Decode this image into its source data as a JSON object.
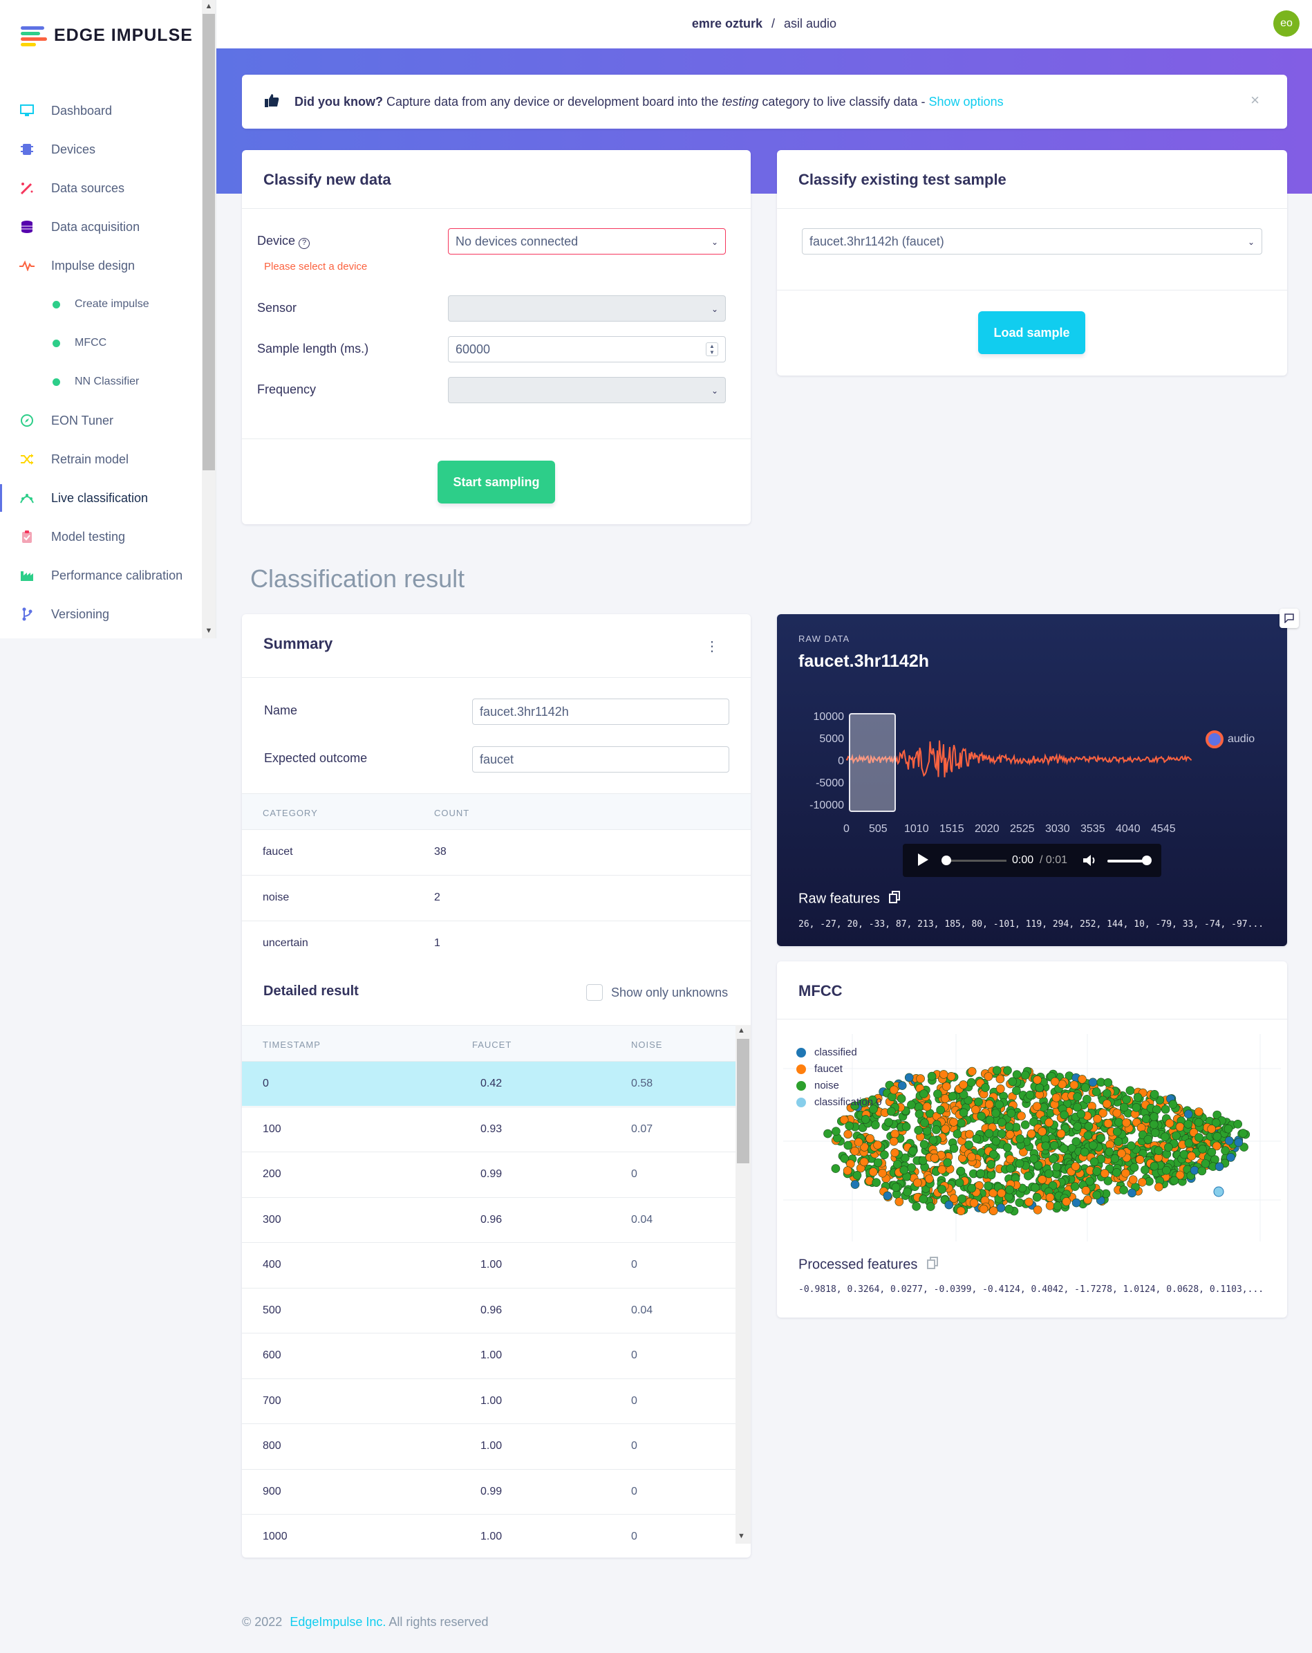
{
  "app": {
    "logo_text": "EDGE IMPULSE"
  },
  "sidebar": {
    "items": [
      {
        "label": "Dashboard",
        "icon": "monitor-icon"
      },
      {
        "label": "Devices",
        "icon": "chip-icon"
      },
      {
        "label": "Data sources",
        "icon": "wand-icon"
      },
      {
        "label": "Data acquisition",
        "icon": "database-icon"
      },
      {
        "label": "Impulse design",
        "icon": "pulse-icon"
      },
      {
        "label": "Create impulse",
        "icon": "dot-icon"
      },
      {
        "label": "MFCC",
        "icon": "dot-icon"
      },
      {
        "label": "NN Classifier",
        "icon": "dot-icon"
      },
      {
        "label": "EON Tuner",
        "icon": "compass-icon"
      },
      {
        "label": "Retrain model",
        "icon": "shuffle-icon"
      },
      {
        "label": "Live classification",
        "icon": "live-icon"
      },
      {
        "label": "Model testing",
        "icon": "clipboard-icon"
      },
      {
        "label": "Performance calibration",
        "icon": "factory-icon"
      },
      {
        "label": "Versioning",
        "icon": "branch-icon"
      }
    ],
    "active": "Live classification"
  },
  "header": {
    "user": "emre ozturk",
    "separator": "/",
    "project": "asil audio",
    "avatar": "eo"
  },
  "tip": {
    "bold": "Did you know?",
    "text_before": "Capture data from any device or development board into the",
    "italic": "testing",
    "text_after": "category to live classify data -",
    "link": "Show options",
    "close": "×"
  },
  "classify_new": {
    "title": "Classify new data",
    "device_label": "Device",
    "device_value": "No devices connected",
    "device_error": "Please select a device",
    "sensor_label": "Sensor",
    "sensor_value": "",
    "length_label": "Sample length (ms.)",
    "length_value": "60000",
    "frequency_label": "Frequency",
    "frequency_value": "",
    "button": "Start sampling"
  },
  "classify_existing": {
    "title": "Classify existing test sample",
    "sample_value": "faucet.3hr1142h (faucet)",
    "button": "Load sample"
  },
  "result": {
    "heading": "Classification result",
    "summary_title": "Summary",
    "menu": "⋮",
    "name_label": "Name",
    "name_value": "faucet.3hr1142h",
    "expected_label": "Expected outcome",
    "expected_value": "faucet",
    "col_category": "CATEGORY",
    "col_count": "COUNT",
    "counts": [
      {
        "category": "faucet",
        "count": "38"
      },
      {
        "category": "noise",
        "count": "2"
      },
      {
        "category": "uncertain",
        "count": "1"
      }
    ],
    "detailed_title": "Detailed result",
    "unknowns_label": "Show only unknowns",
    "col_timestamp": "TIMESTAMP",
    "col_faucet": "FAUCET",
    "col_noise": "NOISE",
    "rows": [
      {
        "t": "0",
        "faucet": "0.42",
        "noise": "0.58"
      },
      {
        "t": "100",
        "faucet": "0.93",
        "noise": "0.07"
      },
      {
        "t": "200",
        "faucet": "0.99",
        "noise": "0"
      },
      {
        "t": "300",
        "faucet": "0.96",
        "noise": "0.04"
      },
      {
        "t": "400",
        "faucet": "1.00",
        "noise": "0"
      },
      {
        "t": "500",
        "faucet": "0.96",
        "noise": "0.04"
      },
      {
        "t": "600",
        "faucet": "1.00",
        "noise": "0"
      },
      {
        "t": "700",
        "faucet": "1.00",
        "noise": "0"
      },
      {
        "t": "800",
        "faucet": "1.00",
        "noise": "0"
      },
      {
        "t": "900",
        "faucet": "0.99",
        "noise": "0"
      },
      {
        "t": "1000",
        "faucet": "1.00",
        "noise": "0"
      }
    ]
  },
  "raw": {
    "kicker": "RAW DATA",
    "title": "faucet.3hr1142h",
    "y_ticks": [
      "10000",
      "5000",
      "0",
      "-5000",
      "-10000"
    ],
    "x_ticks": [
      "0",
      "505",
      "1010",
      "1515",
      "2020",
      "2525",
      "3030",
      "3535",
      "4040",
      "4545"
    ],
    "legend": "audio",
    "time": "0:00",
    "duration": "/ 0:01",
    "features_label": "Raw features",
    "features": "26, -27, 20, -33, 87, 213, 185, 80, -101, 119, 294, 252, 144, 10, -79, 33, -74, -97..."
  },
  "mfcc": {
    "title": "MFCC",
    "legend": [
      "classified",
      "faucet",
      "noise",
      "classification 0"
    ],
    "colors": {
      "classified": "#1f77b4",
      "faucet": "#ff7f0e",
      "noise": "#2ca02c",
      "classification": "#87ceeb"
    },
    "features_label": "Processed features",
    "features": "-0.9818, 0.3264, 0.0277, -0.0399, -0.4124, 0.4042, -1.7278, 1.0124, 0.0628, 0.1103,..."
  },
  "footer": {
    "copy": "© 2022",
    "company": "EdgeImpulse Inc.",
    "rights": "All rights reserved"
  }
}
